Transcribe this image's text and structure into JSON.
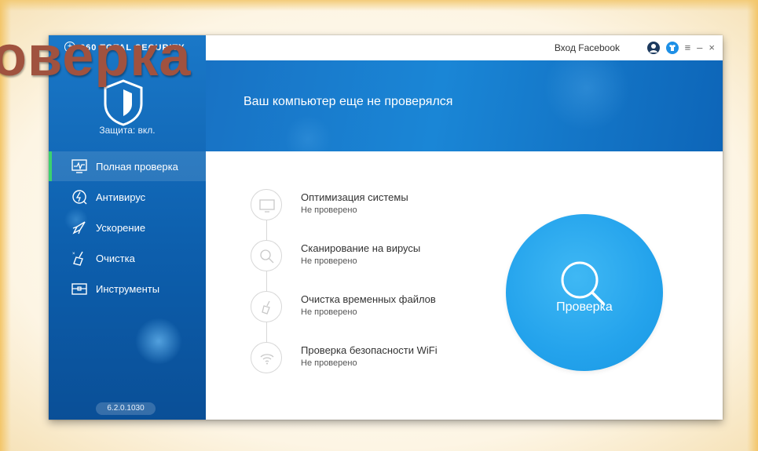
{
  "slide": {
    "title_fragment": "оверка"
  },
  "app": {
    "brand": "360 TOTAL SECURITY",
    "version": "6.2.0.1030",
    "protection_label": "Защита: вкл."
  },
  "topbar": {
    "facebook_login": "Вход Facebook",
    "menu_glyph": "≡",
    "minimize_glyph": "–",
    "close_glyph": "×"
  },
  "sidebar": {
    "items": [
      {
        "label": "Полная проверка",
        "icon": "monitor-pulse-icon",
        "active": true
      },
      {
        "label": "Антивирус",
        "icon": "shield-bolt-icon",
        "active": false
      },
      {
        "label": "Ускорение",
        "icon": "rocket-icon",
        "active": false
      },
      {
        "label": "Очистка",
        "icon": "broom-icon",
        "active": false
      },
      {
        "label": "Инструменты",
        "icon": "toolbox-icon",
        "active": false
      }
    ]
  },
  "banner": {
    "title": "Ваш компьютер еще не проверялся"
  },
  "steps": [
    {
      "title": "Оптимизация системы",
      "status": "Не проверено",
      "icon": "monitor-icon"
    },
    {
      "title": "Сканирование на вирусы",
      "status": "Не проверено",
      "icon": "magnifier-icon"
    },
    {
      "title": "Очистка временных файлов",
      "status": "Не проверено",
      "icon": "broom-icon"
    },
    {
      "title": "Проверка безопасности WiFi",
      "status": "Не проверено",
      "icon": "wifi-icon"
    }
  ],
  "scan_button": {
    "label": "Проверка",
    "icon": "search-icon"
  },
  "colors": {
    "sidebar": "#0d5fad",
    "banner": "#1a86d6",
    "scan_button": "#24a3ec",
    "active_indicator": "#3bd16f",
    "slide_title": "#a0523f"
  }
}
